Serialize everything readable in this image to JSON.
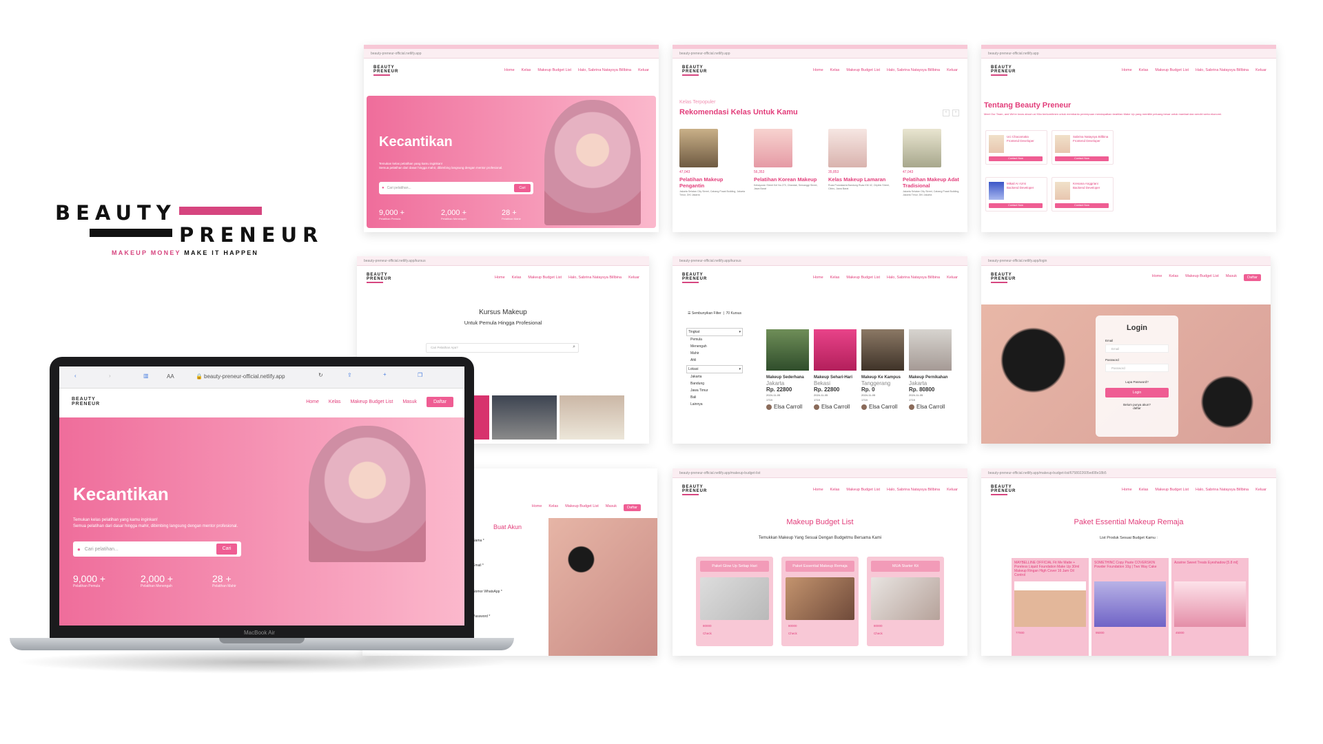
{
  "brand": {
    "word1": "BEAUTY",
    "word2": "PRENEUR",
    "tag_pink": "MAKEUP MONEY",
    "tag_black": "MAKE IT HAPPEN"
  },
  "urls": {
    "home": "beauty-preneur-official.netlify.app",
    "kursus": "beauty-preneur-official.netlify.app/kursus",
    "login": "beauty-preneur-official.netlify.app/login",
    "budget": "beauty-preneur-official.netlify.app/makeup-budget-list",
    "budget_detail": "beauty-preneur-official.netlify.app/makeup-budget-list/6758022605ed08e18b5"
  },
  "nav": {
    "home": "Home",
    "kelas": "Kelas",
    "budget": "Makeup Budget List",
    "user": "Halo, Sabrina Nataysya Billbina",
    "keluar": "Keluar",
    "masuk": "Masuk",
    "daftar": "Daftar"
  },
  "hero": {
    "title": "Kecantikan",
    "desc1": "Temukan kelas pelatihan yang kamu inginkan!",
    "desc2": "Semua pelatihan dari dasar hingga mahir, dibimbing langsung dengan mentor profesional.",
    "search_placeholder": "Cari pelatihan...",
    "search_btn": "Cari",
    "stats": [
      {
        "n": "9,000 +",
        "l": "Pelatihan Pemula"
      },
      {
        "n": "2,000 +",
        "l": "Pelatihan Menengah"
      },
      {
        "n": "28 +",
        "l": "Pelatihan Mahir"
      }
    ]
  },
  "rekom": {
    "label": "Kelas Terpopuler",
    "title": "Rekomendasi Kelas Untuk Kamu",
    "items": [
      {
        "price": "47,043",
        "title": "Pelatihan Makeup Pengantin",
        "addr": "Jakarta Selatan City Street, Cabang Pusat Building, Jakarta Timur, DKI Jakarta"
      },
      {
        "price": "56,353",
        "title": "Pelatihan Korean Makeup",
        "addr": "Kebayoran Street Kel No.270, Cilandak, Semanggi Street, Jawa Barat"
      },
      {
        "price": "35,853",
        "title": "Kelas Makeup Lamaran",
        "addr": "Ruas Purwakarta Bandung Ruas KM 42, Citylink Street, Cibiru, Jawa Barat"
      },
      {
        "price": "47,043",
        "title": "Pelatihan Makeup Adat Tradisional",
        "addr": "Jakarta Selatan City Street, Cabang Pusat Building, Jakarta Timur, DKI Jakarta"
      }
    ]
  },
  "about": {
    "title": "Tentang Beauty Preneur",
    "desc": "Meet Our Team, and We're know about us! Kita berkomitmen untuk membantu perempuan mendapatkan keahlian Make Up yang memiliki peluang besar untuk manfaat dan sendiri serta ekonomi.",
    "team": [
      {
        "name": "Uci Chacamaka",
        "role": "Frontend Developer"
      },
      {
        "name": "Sabrina Nataysya Billbina",
        "role": "Frontend Developer"
      },
      {
        "name": "Mikail Ar Azmi",
        "role": "Backend Developer"
      },
      {
        "name": "Kresana Anggriani",
        "role": "Backend Developer"
      }
    ],
    "contact": "Contact Now"
  },
  "kursus": {
    "title": "Kursus Makeup",
    "subtitle": "Untuk Pemula Hingga Profesional",
    "search_placeholder": "Cari Pelatihan Apa?"
  },
  "filter": {
    "hide": "Sembunyikan Filter",
    "count": "70 Kursus",
    "tingkat": "Tingkat",
    "levels": [
      "Pemula",
      "Menengah",
      "Mahir",
      "Ahli"
    ],
    "lokasi": "Lokasi",
    "locations": [
      "Jakarta",
      "Bandung",
      "Jawa Timur",
      "Bali",
      "Lainnya"
    ],
    "courses": [
      {
        "t": "Makeup Sederhana",
        "loc": "Jakarta",
        "p": "Rp. 22800",
        "date": "2024-11-05",
        "n": "1719",
        "au": "Elsa Carroll"
      },
      {
        "t": "Makeup Sehari-Hari",
        "loc": "Bekasi",
        "p": "Rp. 22800",
        "date": "2024-11-05",
        "n": "1719",
        "au": "Elsa Carroll"
      },
      {
        "t": "Makeup Ke Kampus",
        "loc": "Tanggerang",
        "p": "Rp. 0",
        "date": "2024-11-05",
        "n": "1719",
        "au": "Elsa Carroll"
      },
      {
        "t": "Makeup Pernikahan",
        "loc": "Jakarta",
        "p": "Rp. 80800",
        "date": "2024-11-05",
        "n": "1719",
        "au": "Elsa Carroll"
      }
    ]
  },
  "login": {
    "title": "Login",
    "email": "Email",
    "email_ph": "Email",
    "password": "Password",
    "password_ph": "Password",
    "forgot": "Lupa Password?",
    "btn": "Login",
    "noacc": "Belum punya akun?",
    "daftar": "daftar"
  },
  "register": {
    "title": "Buat Akun",
    "fields": [
      "Nama *",
      "Email *",
      "Nomor WhatsApp *",
      "Password *"
    ]
  },
  "budget": {
    "title": "Makeup Budget List",
    "subtitle": "Temukkan Makeup Yang Sesuai Dengan Budgetmu Bersama Kami",
    "packs": [
      {
        "h": "Paket Glow Up Setiap Hari",
        "pr": "80000",
        "ck": "Check"
      },
      {
        "h": "Paket Essential Makeup Remaja",
        "pr": "80000",
        "ck": "Check"
      },
      {
        "h": "MUA Starter Kit",
        "pr": "80000",
        "ck": "Check"
      }
    ]
  },
  "paket": {
    "title": "Paket Essential Makeup Remaja",
    "subtitle": "List Produk Sesuai Budget Kamu :",
    "products": [
      {
        "t": "MAYBELLINE OFFICIAL Fit Me Matte + Poreless Liquid Foundation Make Up 30ml Makeup Ringan High Cover 16 Jam Oil Control",
        "pr": "77000"
      },
      {
        "t": "SOMETHINC Copy Paste COVERSKIN Powder Foundation 10g | Two Way Cake",
        "pr": "95000"
      },
      {
        "t": "Azarine Sweet Treats Eyeshadow [5.8 ml]",
        "pr": "45000"
      }
    ]
  },
  "laptop": {
    "url": "beauty-preneur-official.netlify.app",
    "aa": "AA",
    "model": "MacBook Air"
  },
  "colors": {
    "accent": "#e23d7a",
    "button": "#ef5d93",
    "hero_from": "#ef6d9b",
    "hero_to": "#fbb8cc"
  }
}
